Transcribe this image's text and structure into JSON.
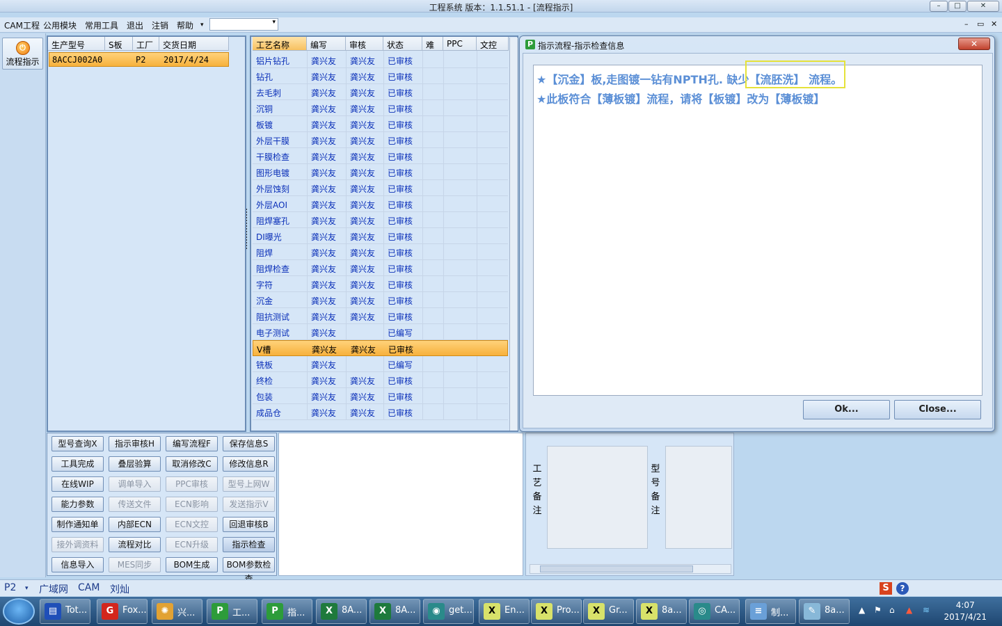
{
  "window": {
    "title": "工程系统    版本：1.1.51.1 - [流程指示]",
    "min": "–",
    "max": "□",
    "close": "✕"
  },
  "menu": {
    "items": [
      "CAM工程",
      "公用模块",
      "常用工具",
      "退出",
      "注销",
      "帮助"
    ],
    "help_arrow": "▾",
    "combo_value": "",
    "combo_arrow": "▾"
  },
  "mdi_controls": [
    "–",
    "▭",
    "✕"
  ],
  "left_strip": {
    "flow_button": "流程指示",
    "flow_icon": "power-icon"
  },
  "model_table": {
    "headers": [
      "生产型号",
      "S板",
      "工厂",
      "交货日期"
    ],
    "row": [
      "8ACCJ002A0",
      "",
      "P2",
      "2017/4/24"
    ]
  },
  "process_table": {
    "headers": [
      "工艺名称",
      "编写",
      "审核",
      "状态",
      "难",
      "PPC",
      "文控"
    ],
    "rows": [
      [
        "铝片钻孔",
        "龚兴友",
        "龚兴友",
        "已审核"
      ],
      [
        "钻孔",
        "龚兴友",
        "龚兴友",
        "已审核"
      ],
      [
        "去毛刺",
        "龚兴友",
        "龚兴友",
        "已审核"
      ],
      [
        "沉铜",
        "龚兴友",
        "龚兴友",
        "已审核"
      ],
      [
        "板镀",
        "龚兴友",
        "龚兴友",
        "已审核"
      ],
      [
        "外层干膜",
        "龚兴友",
        "龚兴友",
        "已审核"
      ],
      [
        "干膜检查",
        "龚兴友",
        "龚兴友",
        "已审核"
      ],
      [
        "图形电镀",
        "龚兴友",
        "龚兴友",
        "已审核"
      ],
      [
        "外层蚀刻",
        "龚兴友",
        "龚兴友",
        "已审核"
      ],
      [
        "外层AOI",
        "龚兴友",
        "龚兴友",
        "已审核"
      ],
      [
        "阻焊塞孔",
        "龚兴友",
        "龚兴友",
        "已审核"
      ],
      [
        "DI曝光",
        "龚兴友",
        "龚兴友",
        "已审核"
      ],
      [
        "阻焊",
        "龚兴友",
        "龚兴友",
        "已审核"
      ],
      [
        "阻焊检查",
        "龚兴友",
        "龚兴友",
        "已审核"
      ],
      [
        "字符",
        "龚兴友",
        "龚兴友",
        "已审核"
      ],
      [
        "沉金",
        "龚兴友",
        "龚兴友",
        "已审核"
      ],
      [
        "阻抗测试",
        "龚兴友",
        "龚兴友",
        "已审核"
      ],
      [
        "电子测试",
        "龚兴友",
        "",
        "已编写"
      ],
      [
        "V槽",
        "龚兴友",
        "龚兴友",
        "已审核"
      ],
      [
        "铣板",
        "龚兴友",
        "",
        "已编写"
      ],
      [
        "终检",
        "龚兴友",
        "龚兴友",
        "已审核"
      ],
      [
        "包装",
        "龚兴友",
        "龚兴友",
        "已审核"
      ],
      [
        "成品仓",
        "龚兴友",
        "龚兴友",
        "已审核"
      ]
    ],
    "selected_index": 18
  },
  "toolbar_buttons": [
    [
      {
        "label": "型号查询X",
        "enabled": true
      },
      {
        "label": "指示审核H",
        "enabled": true
      },
      {
        "label": "编写流程F",
        "enabled": true
      },
      {
        "label": "保存信息S",
        "enabled": true
      }
    ],
    [
      {
        "label": "工具完成",
        "enabled": true
      },
      {
        "label": "叠层验算",
        "enabled": true
      },
      {
        "label": "取消修改C",
        "enabled": true
      },
      {
        "label": "修改信息R",
        "enabled": true
      }
    ],
    [
      {
        "label": "在线WIP",
        "enabled": true
      },
      {
        "label": "调单导入",
        "enabled": false
      },
      {
        "label": "PPC审核",
        "enabled": false
      },
      {
        "label": "型号上网W",
        "enabled": false
      }
    ],
    [
      {
        "label": "能力参数",
        "enabled": true
      },
      {
        "label": "传送文件",
        "enabled": false
      },
      {
        "label": "ECN影响",
        "enabled": false
      },
      {
        "label": "发送指示V",
        "enabled": false
      }
    ],
    [
      {
        "label": "制作通知单",
        "enabled": true
      },
      {
        "label": "内部ECN",
        "enabled": true
      },
      {
        "label": "ECN文控",
        "enabled": false
      },
      {
        "label": "回退审核B",
        "enabled": true
      }
    ],
    [
      {
        "label": "接外调资料",
        "enabled": false
      },
      {
        "label": "流程对比",
        "enabled": true
      },
      {
        "label": "ECN升级",
        "enabled": false
      },
      {
        "label": "指示检查",
        "enabled": true
      }
    ],
    [
      {
        "label": "信息导入",
        "enabled": true
      },
      {
        "label": "MES同步",
        "enabled": false
      },
      {
        "label": "BOM生成",
        "enabled": true
      },
      {
        "label": "BOM参数检查",
        "enabled": true
      }
    ]
  ],
  "notes": {
    "process_note_label": "工艺备注",
    "model_note_label": "型号备注"
  },
  "dialog": {
    "title": "指示流程-指示检查信息",
    "close": "✕",
    "line1": "★【沉金】板,走图镀一钻有NPTH孔. 缺少【流胚洗】 流程。",
    "line2": "★此板符合【薄板镀】流程，请将【板镀】改为【薄板镀】",
    "ok": "Ok...",
    "cancel": "Close..."
  },
  "status_bar": {
    "factory": "P2",
    "items": [
      "广域网",
      "CAM",
      "刘灿"
    ]
  },
  "taskbar": {
    "items": [
      {
        "label": "Tot...",
        "icon": "save-icon",
        "color": "#1f4fb8"
      },
      {
        "label": "Fox...",
        "icon": "foxit-icon",
        "color": "#d3261c"
      },
      {
        "label": "兴...",
        "icon": "shell-icon",
        "color": "#e2a233"
      },
      {
        "label": "工...",
        "icon": "p-app-icon",
        "color": "#2d9c3a"
      },
      {
        "label": "指...",
        "icon": "p-app-icon",
        "color": "#2d9c3a"
      },
      {
        "label": "8A...",
        "icon": "excel-icon",
        "color": "#1e7a3c"
      },
      {
        "label": "8A...",
        "icon": "excel-icon",
        "color": "#1e7a3c"
      },
      {
        "label": "get...",
        "icon": "eye-icon",
        "color": "#2a8a8a"
      },
      {
        "label": "En...",
        "icon": "x-window-icon",
        "color": "#d8e26a"
      },
      {
        "label": "Pro...",
        "icon": "x-window-icon",
        "color": "#d8e26a"
      },
      {
        "label": "Gr...",
        "icon": "x-window-icon",
        "color": "#d8e26a"
      },
      {
        "label": "8a...",
        "icon": "x-window-icon",
        "color": "#d8e26a"
      },
      {
        "label": "CA...",
        "icon": "cam-icon",
        "color": "#2a8a8a"
      },
      {
        "label": "制...",
        "icon": "notepad-icon",
        "color": "#6aa0d8"
      },
      {
        "label": "8a...",
        "icon": "pen-icon",
        "color": "#88b8d8"
      }
    ],
    "time": "4:07",
    "date": "2017/4/21"
  }
}
